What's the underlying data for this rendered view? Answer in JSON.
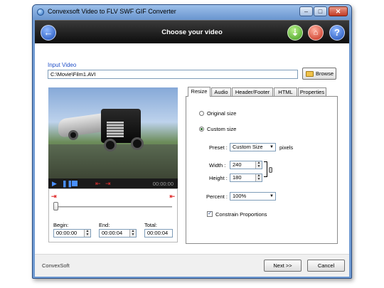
{
  "window": {
    "title": "Convexsoft Video to FLV  SWF  GIF Converter",
    "min_label": "–",
    "max_label": "□",
    "close_label": "✕"
  },
  "header": {
    "title": "Choose your video",
    "back_icon": "←",
    "download_icon": "⇣",
    "home_icon": "⌂",
    "help_icon": "?"
  },
  "input": {
    "label": "Input Video",
    "value": "C:\\Movie\\Film1.AVI",
    "browse_label": "Browse"
  },
  "player": {
    "play": "▶",
    "pause": "❚❚",
    "mark_in": "⇤",
    "mark_out": "⇥",
    "time": "00:00:00"
  },
  "trim": {
    "begin_label": "Begin:",
    "begin_value": "00:00:00",
    "end_label": "End:",
    "end_value": "00:00:04",
    "total_label": "Total:",
    "total_value": "00:00:04",
    "position": 0
  },
  "tabs": [
    "Resize",
    "Audio",
    "Header/Footer",
    "HTML",
    "Properties"
  ],
  "resize": {
    "original_label": "Original size",
    "custom_label": "Custom size",
    "preset_label": "Preset :",
    "preset_value": "Custom Size",
    "pixels_label": "pixels",
    "width_label": "Width :",
    "width_value": "240",
    "height_label": "Height :",
    "height_value": "180",
    "percent_label": "Percent :",
    "percent_value": "100%",
    "constrain_label": "Constrain Proportions"
  },
  "footer": {
    "brand": "ConvexSoft",
    "next_label": "Next >>",
    "cancel_label": "Cancel"
  }
}
